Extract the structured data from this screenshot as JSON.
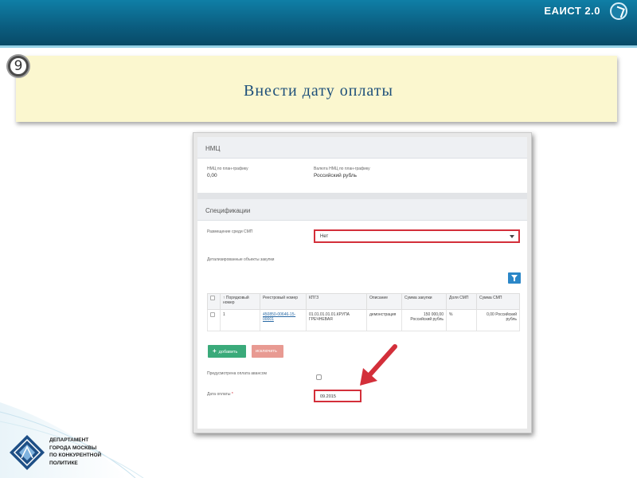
{
  "header": {
    "brand": "ЕАИСТ 2.0",
    "brand_icon": "eaist-logo-icon"
  },
  "step": {
    "number": "9",
    "instruction": "Внести дату оплаты"
  },
  "form": {
    "nmc_section": {
      "title": "НМЦ",
      "nmc_label": "НМЦ по план-графику",
      "nmc_value": "0,00",
      "currency_label": "Валюта НМЦ по план-графику",
      "currency_value": "Российский рубль"
    },
    "spec_section": {
      "title": "Спецификации",
      "smp_label": "Размещение среди СМП",
      "smp_value": "Нет",
      "objects_label": "Детализированные объекты закупки",
      "table": {
        "columns": [
          "",
          "↑ Порядковый номер",
          "Реестровый номер",
          "КПГЗ",
          "Описание",
          "Сумма закупки",
          "Доля СМП",
          "Сумма СМП"
        ],
        "rows": [
          [
            "",
            "1",
            "450850-00646-15-00001",
            "01.01.01.01.01.КРУПА ГРЕЧНЕВАЯ",
            "демонстрация",
            "150 000,00 Российский рубль",
            "%",
            "0,00 Российский рубль"
          ]
        ]
      },
      "add_button": "добавить",
      "delete_button": "исключить",
      "advance_label": "Предусмотрена оплата авансом",
      "date_label": "Дата оплаты",
      "required_mark": "*",
      "date_value": "09.2015"
    }
  },
  "footer": {
    "dept_lines": [
      "ДЕПАРТАМЕНТ",
      "ГОРОДА МОСКВЫ",
      "ПО КОНКУРЕНТНОЙ",
      "ПОЛИТИКЕ"
    ]
  },
  "colors": {
    "accent": "#0b5f82",
    "highlight": "#d32f3a",
    "callout": "#fbf7cf"
  }
}
